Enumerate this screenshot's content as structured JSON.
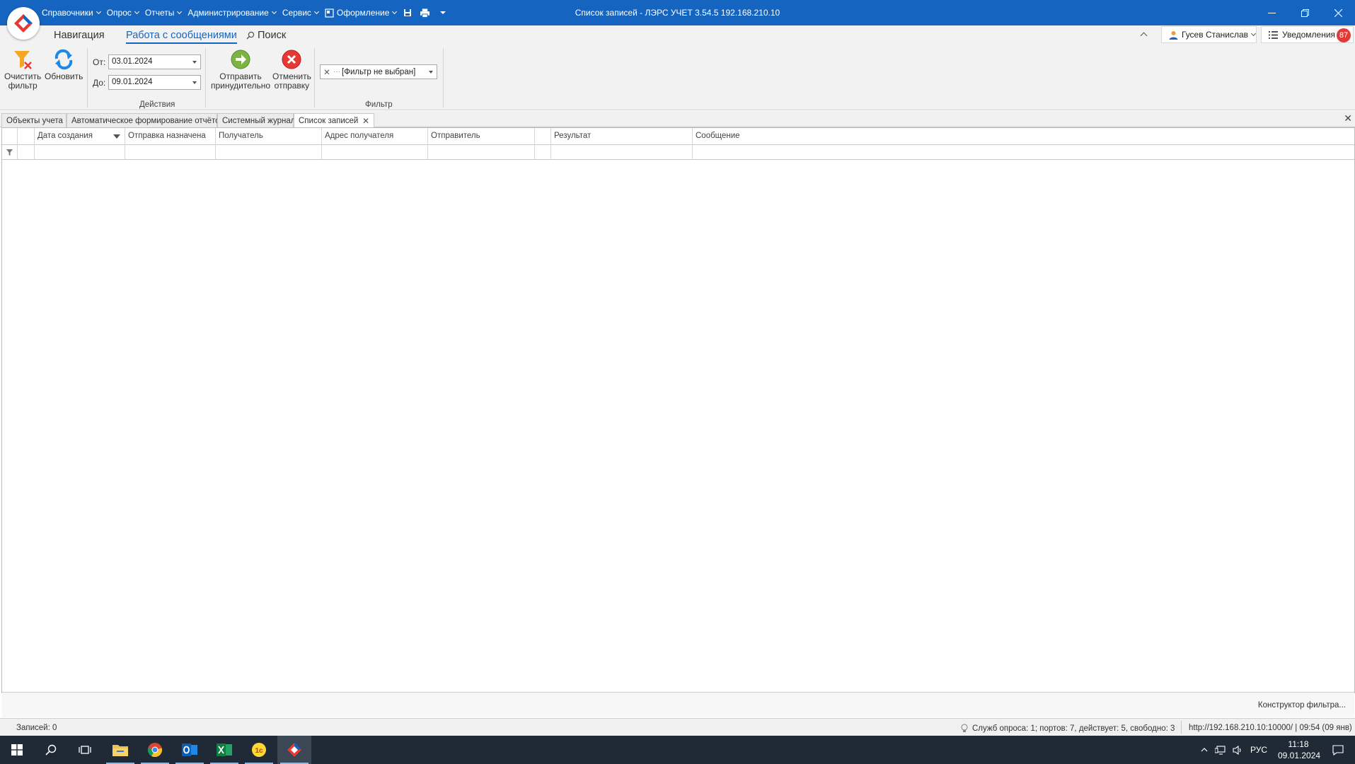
{
  "titlebar": {
    "menus": [
      "Справочники",
      "Опрос",
      "Отчеты",
      "Администрирование",
      "Сервис",
      "Оформление"
    ],
    "window_title": "Список записей - ЛЭРС УЧЕТ 3.54.5 192.168.210.10"
  },
  "ribbon_tabs": {
    "navigation": "Навигация",
    "messages": "Работа с сообщениями",
    "search": "Поиск",
    "user": "Гусев Станислав",
    "notifications": "Уведомления",
    "notifications_count": "87"
  },
  "ribbon": {
    "clear_filter_line1": "Очистить",
    "clear_filter_line2": "фильтр",
    "refresh": "Обновить",
    "from_label": "От:",
    "from_value": "03.01.2024",
    "to_label": "До:",
    "to_value": "09.01.2024",
    "send_line1": "Отправить",
    "send_line2": "принудительно",
    "cancel_line1": "Отменить",
    "cancel_line2": "отправку",
    "actions_group": "Действия",
    "filter_value": "[Фильтр не выбран]",
    "filter_group": "Фильтр"
  },
  "doc_tabs": [
    "Объекты учета",
    "Автоматическое формирование отчёто",
    "Системный журнал",
    "Список записей"
  ],
  "grid": {
    "columns": [
      "Дата создания",
      "Отправка назначена",
      "Получатель",
      "Адрес получателя",
      "Отправитель",
      "",
      "Результат",
      "Сообщение"
    ],
    "footer_link": "Конструктор фильтра..."
  },
  "statusbar": {
    "records": "Записей: 0",
    "services": "Служб опроса: 1; портов: 7, действует: 5, свободно: 3",
    "server": "http://192.168.210.10:10000/ | 09:54 (09 янв)"
  },
  "taskbar": {
    "lang": "РУС",
    "time": "11:18",
    "date": "09.01.2024"
  },
  "colors": {
    "accent": "#1565c0",
    "badge": "#e53935",
    "taskbar": "#1f2a36"
  }
}
